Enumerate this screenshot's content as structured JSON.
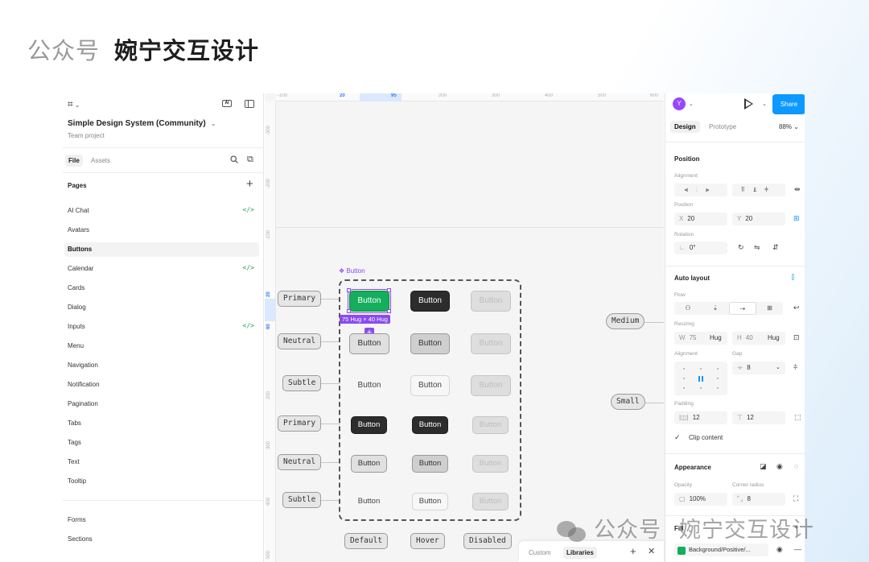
{
  "brand": {
    "account_label": "公众号",
    "account_name": "婉宁交互设计"
  },
  "watermark": {
    "account_label": "公众号",
    "account_name": "婉宁交互设计"
  },
  "left_panel": {
    "file_name": "Simple Design System (Community)",
    "file_sub": "Team project",
    "tabs": {
      "file": "File",
      "assets": "Assets"
    },
    "pages_label": "Pages",
    "pages": [
      {
        "label": "AI Chat",
        "code": true
      },
      {
        "label": "Avatars",
        "code": false
      },
      {
        "label": "Buttons",
        "code": false,
        "active": true
      },
      {
        "label": "Calendar",
        "code": true
      },
      {
        "label": "Cards",
        "code": false
      },
      {
        "label": "Dialog",
        "code": false
      },
      {
        "label": "Inputs",
        "code": true
      },
      {
        "label": "Menu",
        "code": false
      },
      {
        "label": "Navigation",
        "code": false
      },
      {
        "label": "Notification",
        "code": false
      },
      {
        "label": "Pagination",
        "code": false
      },
      {
        "label": "Tabs",
        "code": false
      },
      {
        "label": "Tags",
        "code": false
      },
      {
        "label": "Text",
        "code": false
      },
      {
        "label": "Tooltip",
        "code": false
      },
      {
        "label": "Forms",
        "code": false
      },
      {
        "label": "Sections",
        "code": false
      }
    ],
    "code_glyph": "</>"
  },
  "canvas": {
    "ruler_top": [
      "-100",
      "20",
      "95",
      "200",
      "300",
      "400",
      "500",
      "600"
    ],
    "ruler_left": [
      "-300",
      "-200",
      "-100",
      "20",
      "60",
      "200",
      "300",
      "400",
      "500"
    ],
    "component_label": "❖ Button",
    "size_badge": "75 Hug × 40 Hug",
    "button_text": "Button",
    "row_tags": [
      "Primary",
      "Neutral",
      "Subtle",
      "Primary",
      "Neutral",
      "Subtle"
    ],
    "state_tags": [
      "Default",
      "Hover",
      "Disabled"
    ],
    "size_tags": [
      "Medium",
      "Small"
    ]
  },
  "right_panel": {
    "avatar": "Y",
    "share": "Share",
    "tabs": {
      "design": "Design",
      "prototype": "Prototype"
    },
    "zoom": "88%",
    "position": {
      "title": "Position",
      "alignment_label": "Alignment",
      "position_label": "Position",
      "x_label": "X",
      "x": "20",
      "y_label": "Y",
      "y": "20",
      "rotation_label": "Rotation",
      "rotation": "0°"
    },
    "auto_layout": {
      "title": "Auto layout",
      "flow_label": "Flow",
      "resizing_label": "Resizing",
      "w_label": "W",
      "w": "75",
      "w_mode": "Hug",
      "h_label": "H",
      "h": "40",
      "h_mode": "Hug",
      "alignment_label": "Alignment",
      "gap_label": "Gap",
      "gap": "8",
      "padding_label": "Padding",
      "padding_h": "12",
      "padding_v": "12",
      "clip_label": "Clip content"
    },
    "appearance": {
      "title": "Appearance",
      "opacity_label": "Opacity",
      "opacity": "100%",
      "radius_label": "Corner radius",
      "radius": "8"
    },
    "fill": {
      "title": "Fill",
      "style": "Background/Positive/..."
    }
  },
  "bottom_tabs": {
    "custom": "Custom",
    "libraries": "Libraries"
  }
}
